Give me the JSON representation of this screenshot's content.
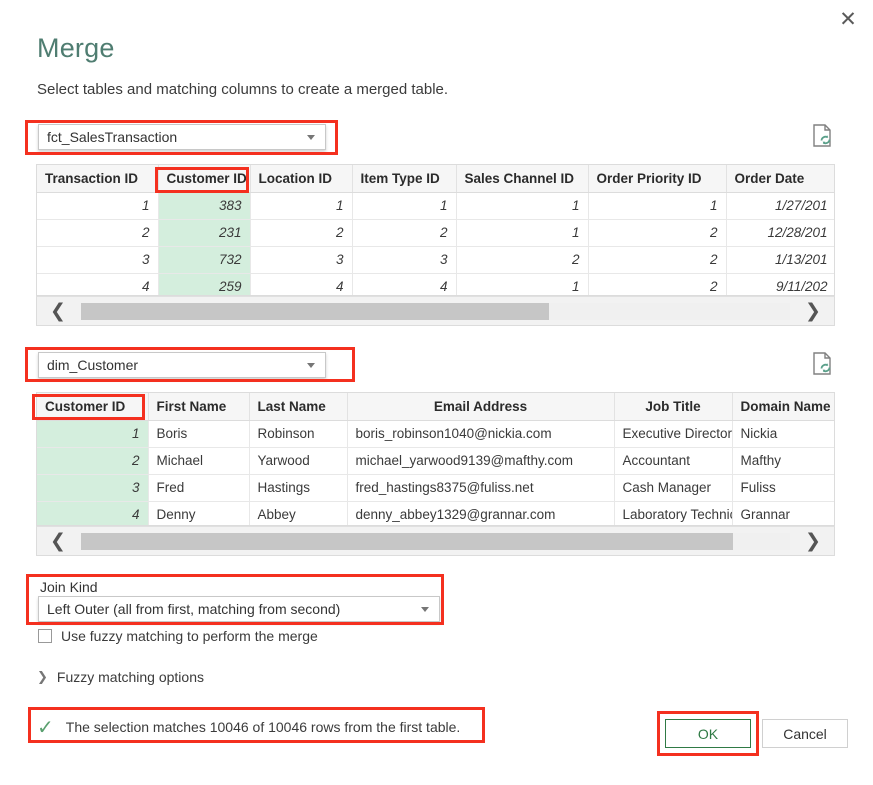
{
  "dialog": {
    "title": "Merge",
    "subtitle": "Select tables and matching columns to create a merged table.",
    "close_icon": "close-icon"
  },
  "accent_colors": {
    "title_green": "#4f7d71",
    "annotation_red": "#f4301f",
    "selected_column_header": "#8fd3ae",
    "selected_column_cell": "#d4eedd",
    "ok_green": "#2f7a45"
  },
  "first_table": {
    "selected_table": "fct_SalesTransaction",
    "refresh_icon": "document-refresh-icon",
    "columns": [
      "Transaction ID",
      "Customer ID",
      "Location ID",
      "Item Type ID",
      "Sales Channel ID",
      "Order Priority ID",
      "Order Date"
    ],
    "selected_column": "Customer ID",
    "rows": [
      [
        "1",
        "383",
        "1",
        "1",
        "1",
        "1",
        "1/27/201"
      ],
      [
        "2",
        "231",
        "2",
        "2",
        "1",
        "2",
        "12/28/201"
      ],
      [
        "3",
        "732",
        "3",
        "3",
        "2",
        "2",
        "1/13/201"
      ],
      [
        "4",
        "259",
        "4",
        "4",
        "1",
        "2",
        "9/11/202"
      ]
    ],
    "scroll_left_icon": "chevron-left-icon",
    "scroll_right_icon": "chevron-right-icon"
  },
  "second_table": {
    "selected_table": "dim_Customer",
    "refresh_icon": "document-refresh-icon",
    "columns": [
      "Customer ID",
      "First Name",
      "Last Name",
      "Email Address",
      "Job Title",
      "Domain Name"
    ],
    "selected_column": "Customer ID",
    "rows": [
      [
        "1",
        "Boris",
        "Robinson",
        "boris_robinson1040@nickia.com",
        "Executive Director",
        "Nickia"
      ],
      [
        "2",
        "Michael",
        "Yarwood",
        "michael_yarwood9139@mafthy.com",
        "Accountant",
        "Mafthy"
      ],
      [
        "3",
        "Fred",
        "Hastings",
        "fred_hastings8375@fuliss.net",
        "Cash Manager",
        "Fuliss"
      ],
      [
        "4",
        "Denny",
        "Abbey",
        "denny_abbey1329@grannar.com",
        "Laboratory Technician",
        "Grannar"
      ]
    ],
    "scroll_left_icon": "chevron-left-icon",
    "scroll_right_icon": "chevron-right-icon"
  },
  "join": {
    "label": "Join Kind",
    "value": "Left Outer (all from first, matching from second)"
  },
  "fuzzy": {
    "checkbox_label": "Use fuzzy matching to perform the merge",
    "checked": false,
    "options_label": "Fuzzy matching options",
    "expander_icon": "chevron-right-icon"
  },
  "status": {
    "icon": "checkmark-icon",
    "message": "The selection matches 10046 of 10046 rows from the first table."
  },
  "buttons": {
    "ok": "OK",
    "cancel": "Cancel"
  }
}
